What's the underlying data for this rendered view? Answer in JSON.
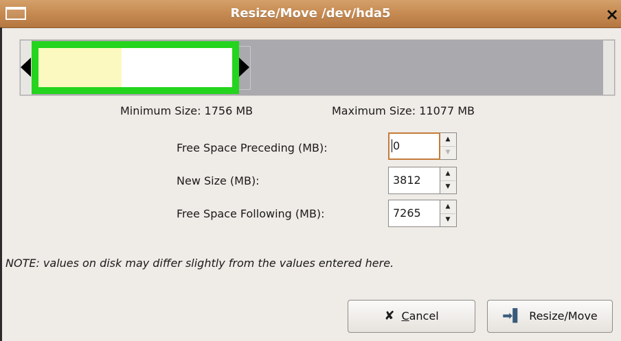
{
  "window": {
    "title": "Resize/Move /dev/hda5",
    "close_glyph": "×",
    "menu_icon": "window-menu-icon"
  },
  "partition_map": {
    "used_fraction": 0.43,
    "colors": {
      "border": "#24d41e",
      "used": "#fbf9bf",
      "unused": "#ffffff",
      "unallocated": "#aaa9ae"
    }
  },
  "limits": {
    "minimum": "Minimum Size: 1756 MB",
    "maximum": "Maximum Size: 11077 MB"
  },
  "fields": [
    {
      "label": "Free Space Preceding (MB):",
      "value": "0"
    },
    {
      "label": "New Size (MB):",
      "value": "3812"
    },
    {
      "label": "Free Space Following (MB):",
      "value": "7265"
    }
  ],
  "note": "NOTE: values on disk may differ slightly from the values entered here.",
  "buttons": {
    "cancel_mnemonic": "C",
    "cancel_rest": "ancel",
    "cancel_icon": "cancel-x-icon",
    "resize": "Resize/Move",
    "resize_icon": "resize-arrow-icon"
  }
}
